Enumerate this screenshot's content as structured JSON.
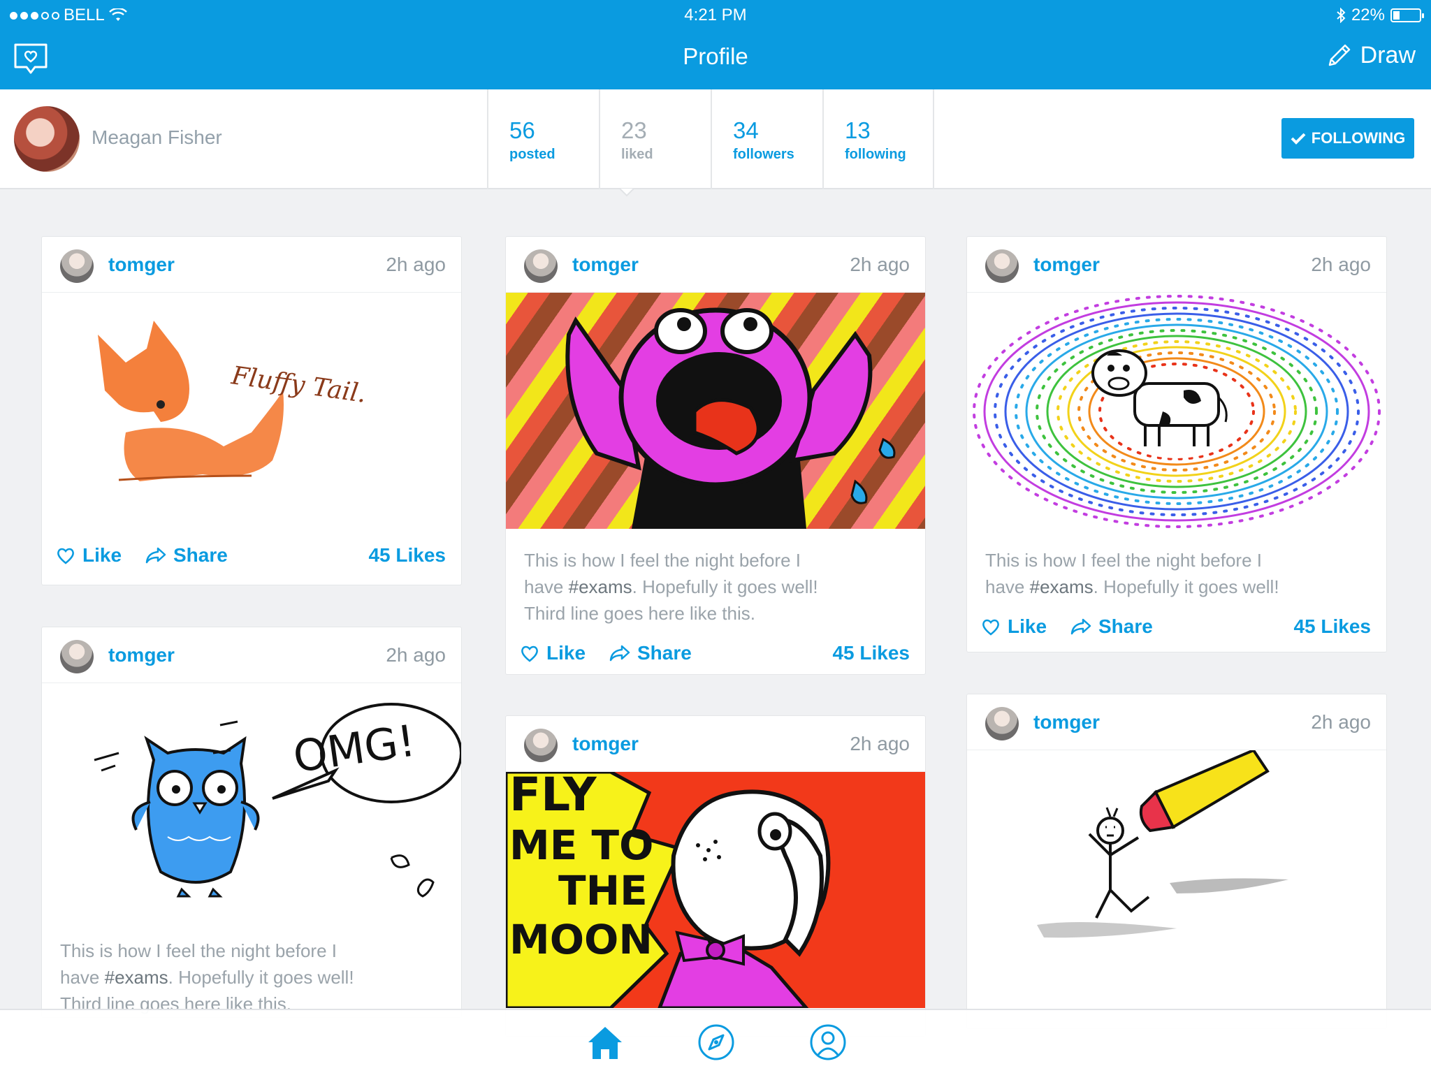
{
  "status": {
    "carrier": "BELL",
    "time": "4:21 PM",
    "battery": "22%"
  },
  "nav": {
    "title": "Profile",
    "draw_label": "Draw"
  },
  "profile": {
    "name": "Meagan Fisher",
    "stats": [
      {
        "num": "56",
        "label": "posted"
      },
      {
        "num": "23",
        "label": "liked"
      },
      {
        "num": "34",
        "label": "followers"
      },
      {
        "num": "13",
        "label": "following"
      }
    ],
    "follow_label": "FOLLOWING"
  },
  "posts": [
    {
      "user": "tomger",
      "time": "2h ago",
      "like": "Like",
      "share": "Share",
      "likes": "45 Likes"
    },
    {
      "user": "tomger",
      "time": "2h ago",
      "caption_lines": [
        "This is how I feel the night before I",
        "have ",
        "#exams",
        ". Hopefully it goes well!",
        "Third line goes here like this."
      ]
    },
    {
      "user": "tomger",
      "time": "2h ago",
      "caption_lines": [
        "This is how I feel the night before I",
        "have ",
        "#exams",
        ". Hopefully it goes well!",
        "Third line goes here like this."
      ],
      "like": "Like",
      "share": "Share",
      "likes": "45 Likes"
    },
    {
      "user": "tomger",
      "time": "2h ago"
    },
    {
      "user": "tomger",
      "time": "2h ago",
      "caption_lines": [
        "This is how I feel the night before I",
        "have ",
        "#exams",
        ". Hopefully it goes well!"
      ],
      "like": "Like",
      "share": "Share",
      "likes": "45 Likes"
    },
    {
      "user": "tomger",
      "time": "2h ago"
    }
  ],
  "art_text": {
    "fox": "Fluffy Tail.",
    "owl": "OMG!",
    "moon": [
      "FLY",
      "ME TO",
      "THE",
      "MOON"
    ]
  },
  "icons": [
    "heart-chat-icon",
    "pencil-icon",
    "check-icon",
    "heart-icon",
    "share-arrow-icon",
    "home-icon",
    "compass-icon",
    "profile-icon",
    "wifi-icon",
    "bluetooth-icon",
    "battery-icon"
  ]
}
